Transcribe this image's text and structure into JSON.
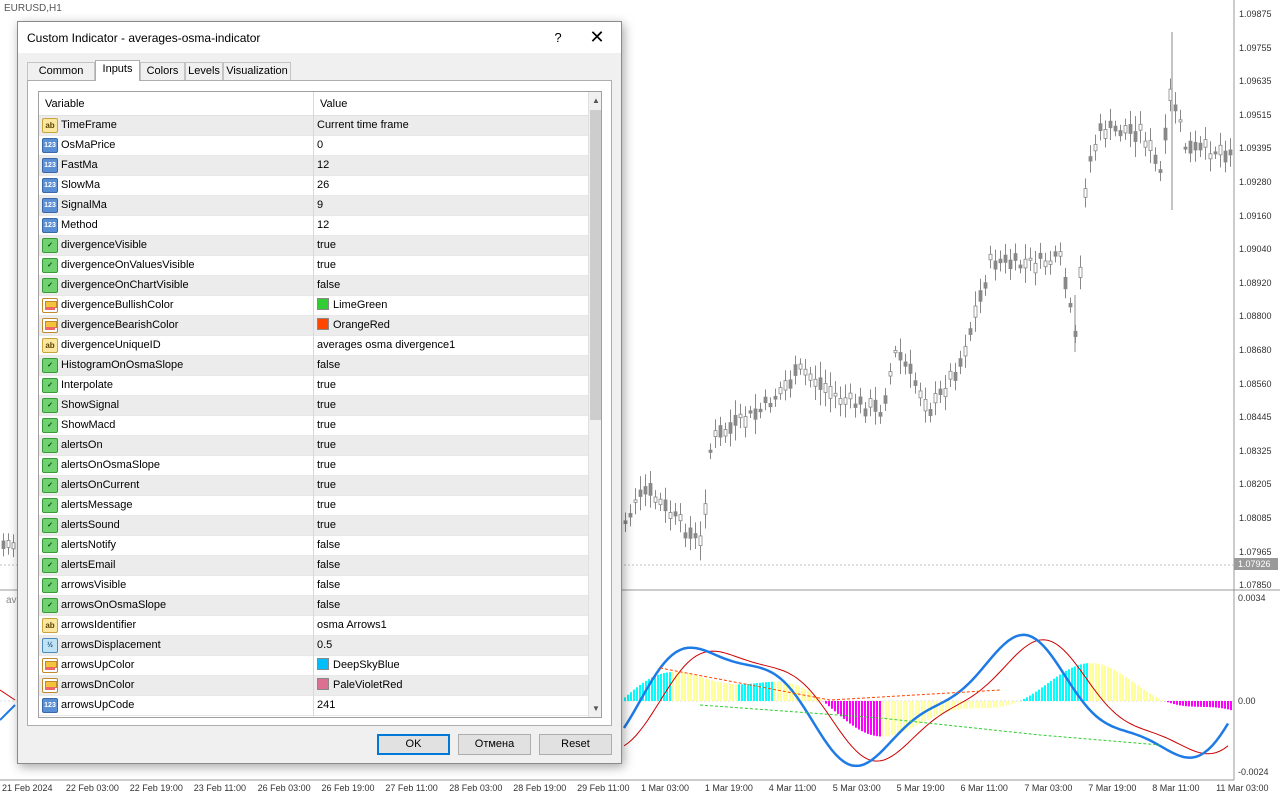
{
  "chart": {
    "symbol": "EURUSD,H1",
    "indicator_short": "av",
    "price_ticks": [
      "1.09875",
      "1.09755",
      "1.09635",
      "1.09515",
      "1.09395",
      "1.09280",
      "1.09160",
      "1.09040",
      "1.08920",
      "1.08800",
      "1.08680",
      "1.08560",
      "1.08445",
      "1.08325",
      "1.08205",
      "1.08085",
      "1.07965",
      "1.07850"
    ],
    "current_price": "1.07926",
    "osc_ticks": [
      "0.0034",
      "0.00",
      "-0.0024"
    ],
    "date_ticks": [
      "21 Feb 2024",
      "22 Feb 03:00",
      "22 Feb 19:00",
      "23 Feb 11:00",
      "26 Feb 03:00",
      "26 Feb 19:00",
      "27 Feb 11:00",
      "28 Feb 03:00",
      "28 Feb 19:00",
      "29 Feb 11:00",
      "1 Mar 03:00",
      "1 Mar 19:00",
      "4 Mar 11:00",
      "5 Mar 03:00",
      "5 Mar 19:00",
      "6 Mar 11:00",
      "7 Mar 03:00",
      "7 Mar 19:00",
      "8 Mar 11:00",
      "11 Mar 03:00"
    ],
    "colors": {
      "bull": "#00ffff",
      "bear": "#ff00ff",
      "macd": "#1e7be6",
      "signal": "#cc0000",
      "candle": "#888888"
    }
  },
  "dialog": {
    "title": "Custom Indicator - averages-osma-indicator",
    "help": "?",
    "close": "✕",
    "tabs": [
      "Common",
      "Inputs",
      "Colors",
      "Levels",
      "Visualization"
    ],
    "active_tab": "Inputs",
    "header": {
      "variable": "Variable",
      "value": "Value"
    },
    "rows": [
      {
        "type": "str",
        "name": "TimeFrame",
        "value": "Current time frame"
      },
      {
        "type": "int",
        "name": "OsMaPrice",
        "value": "0"
      },
      {
        "type": "int",
        "name": "FastMa",
        "value": "12"
      },
      {
        "type": "int",
        "name": "SlowMa",
        "value": "26"
      },
      {
        "type": "int",
        "name": "SignalMa",
        "value": "9"
      },
      {
        "type": "int",
        "name": "Method",
        "value": "12"
      },
      {
        "type": "bool",
        "name": "divergenceVisible",
        "value": "true"
      },
      {
        "type": "bool",
        "name": "divergenceOnValuesVisible",
        "value": "true"
      },
      {
        "type": "bool",
        "name": "divergenceOnChartVisible",
        "value": "false"
      },
      {
        "type": "color",
        "name": "divergenceBullishColor",
        "value": "LimeGreen",
        "swatch": "#32cd32"
      },
      {
        "type": "color",
        "name": "divergenceBearishColor",
        "value": "OrangeRed",
        "swatch": "#ff4500"
      },
      {
        "type": "str",
        "name": "divergenceUniqueID",
        "value": "averages osma divergence1"
      },
      {
        "type": "bool",
        "name": "HistogramOnOsmaSlope",
        "value": "false"
      },
      {
        "type": "bool",
        "name": "Interpolate",
        "value": "true"
      },
      {
        "type": "bool",
        "name": "ShowSignal",
        "value": "true"
      },
      {
        "type": "bool",
        "name": "ShowMacd",
        "value": "true"
      },
      {
        "type": "bool",
        "name": "alertsOn",
        "value": "true"
      },
      {
        "type": "bool",
        "name": "alertsOnOsmaSlope",
        "value": "true"
      },
      {
        "type": "bool",
        "name": "alertsOnCurrent",
        "value": "true"
      },
      {
        "type": "bool",
        "name": "alertsMessage",
        "value": "true"
      },
      {
        "type": "bool",
        "name": "alertsSound",
        "value": "true"
      },
      {
        "type": "bool",
        "name": "alertsNotify",
        "value": "false"
      },
      {
        "type": "bool",
        "name": "alertsEmail",
        "value": "false"
      },
      {
        "type": "bool",
        "name": "arrowsVisible",
        "value": "false"
      },
      {
        "type": "bool",
        "name": "arrowsOnOsmaSlope",
        "value": "false"
      },
      {
        "type": "str",
        "name": "arrowsIdentifier",
        "value": "osma Arrows1"
      },
      {
        "type": "double",
        "name": "arrowsDisplacement",
        "value": "0.5"
      },
      {
        "type": "color",
        "name": "arrowsUpColor",
        "value": "DeepSkyBlue",
        "swatch": "#00bfff"
      },
      {
        "type": "color",
        "name": "arrowsDnColor",
        "value": "PaleVioletRed",
        "swatch": "#db7093"
      },
      {
        "type": "int",
        "name": "arrowsUpCode",
        "value": "241"
      }
    ],
    "icon_glyphs": {
      "str": "ab",
      "int": "123",
      "bool": "✓",
      "color": "",
      "double": "½"
    },
    "buttons": {
      "ok": "OK",
      "cancel": "Отмена",
      "reset": "Reset"
    }
  }
}
